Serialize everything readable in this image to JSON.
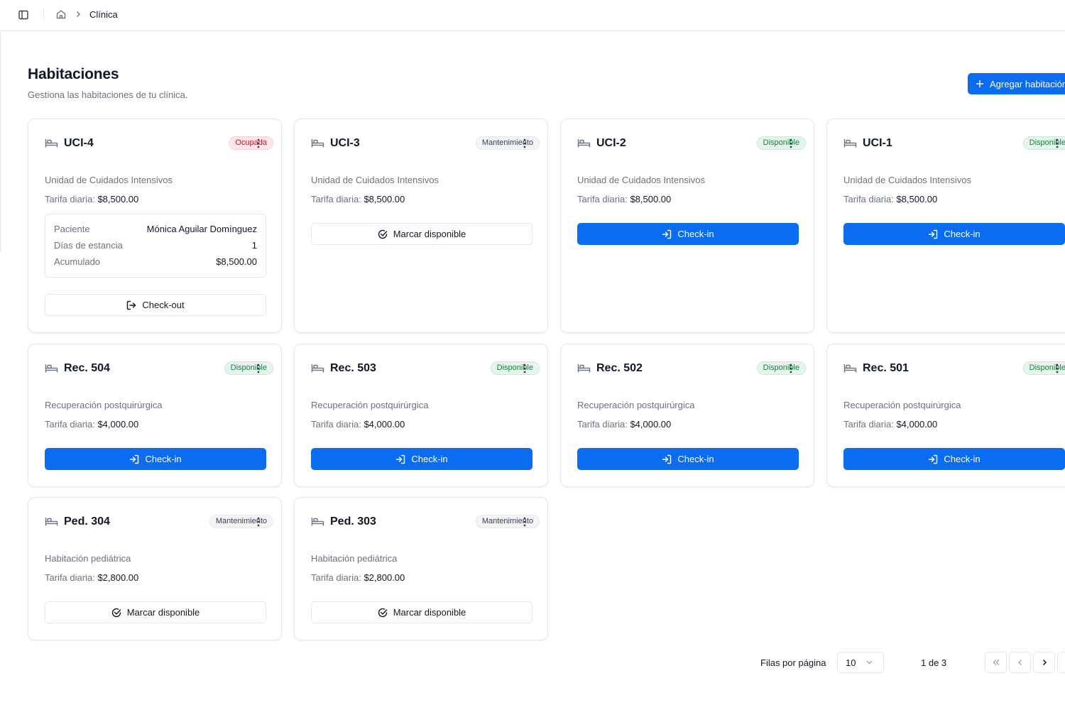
{
  "breadcrumb": {
    "current": "Clínica"
  },
  "header": {
    "title": "Habitaciones",
    "subtitle": "Gestiona las habitaciones de tu clínica.",
    "add_label": "Agregar habitación"
  },
  "labels": {
    "rate_prefix": "Tarifa diaria:",
    "patient": "Paciente",
    "stay_days": "Días de estancia",
    "accumulated": "Acumulado"
  },
  "rooms": [
    {
      "name": "UCI-4",
      "status": "Ocupada",
      "status_type": "ocupada",
      "description": "Unidad de Cuidados Intensivos",
      "rate": "$8,500.00",
      "action": "Check-out",
      "action_type": "checkout",
      "patient": {
        "name": "Mónica Aguilar Domínguez",
        "days": "1",
        "accumulated": "$8,500.00"
      }
    },
    {
      "name": "UCI-3",
      "status": "Mantenimiento",
      "status_type": "mant",
      "description": "Unidad de Cuidados Intensivos",
      "rate": "$8,500.00",
      "action": "Marcar disponible",
      "action_type": "available"
    },
    {
      "name": "UCI-2",
      "status": "Disponible",
      "status_type": "disponible",
      "description": "Unidad de Cuidados Intensivos",
      "rate": "$8,500.00",
      "action": "Check-in",
      "action_type": "checkin"
    },
    {
      "name": "UCI-1",
      "status": "Disponible",
      "status_type": "disponible",
      "description": "Unidad de Cuidados Intensivos",
      "rate": "$8,500.00",
      "action": "Check-in",
      "action_type": "checkin"
    },
    {
      "name": "Rec. 504",
      "status": "Disponible",
      "status_type": "disponible",
      "description": "Recuperación postquirúrgica",
      "rate": "$4,000.00",
      "action": "Check-in",
      "action_type": "checkin"
    },
    {
      "name": "Rec. 503",
      "status": "Disponible",
      "status_type": "disponible",
      "description": "Recuperación postquirúrgica",
      "rate": "$4,000.00",
      "action": "Check-in",
      "action_type": "checkin"
    },
    {
      "name": "Rec. 502",
      "status": "Disponible",
      "status_type": "disponible",
      "description": "Recuperación postquirúrgica",
      "rate": "$4,000.00",
      "action": "Check-in",
      "action_type": "checkin"
    },
    {
      "name": "Rec. 501",
      "status": "Disponible",
      "status_type": "disponible",
      "description": "Recuperación postquirúrgica",
      "rate": "$4,000.00",
      "action": "Check-in",
      "action_type": "checkin"
    },
    {
      "name": "Ped. 304",
      "status": "Mantenimiento",
      "status_type": "mant",
      "description": "Habitación pediátrica",
      "rate": "$2,800.00",
      "action": "Marcar disponible",
      "action_type": "available"
    },
    {
      "name": "Ped. 303",
      "status": "Mantenimiento",
      "status_type": "mant",
      "description": "Habitación pediátrica",
      "rate": "$2,800.00",
      "action": "Marcar disponible",
      "action_type": "available"
    }
  ],
  "pagination": {
    "rows_label": "Filas por página",
    "rows_value": "10",
    "page_info": "1 de 3"
  },
  "icons": {
    "sidebar": "sidebar-toggle-icon",
    "home": "home-icon",
    "bed": "bed-icon",
    "menu": "more-vertical-icon",
    "checkin": "log-in-icon",
    "checkout": "log-out-icon",
    "available": "check-circle-icon",
    "add": "plus-icon"
  },
  "colors": {
    "primary": "#0a6cf0",
    "occupied": "#c8102e",
    "available": "#15803d",
    "border": "#e5e7eb"
  }
}
